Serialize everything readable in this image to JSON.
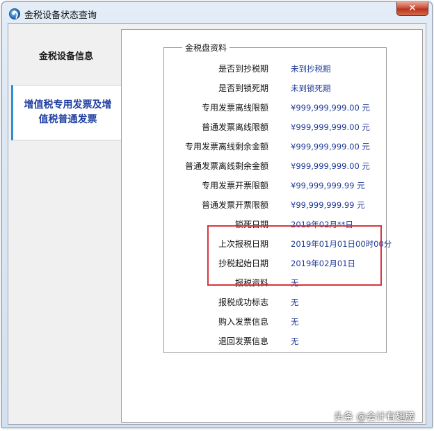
{
  "window": {
    "title": "金税设备状态查询",
    "close_glyph": "✕"
  },
  "nav": {
    "items": [
      {
        "label": "金税设备信息"
      },
      {
        "label": "增值税专用发票及增值税普通发票"
      }
    ]
  },
  "group": {
    "title": "金税盘资料",
    "rows": [
      {
        "label": "是否到抄税期",
        "value": "未到抄税期"
      },
      {
        "label": "是否到锁死期",
        "value": "未到锁死期"
      },
      {
        "label": "专用发票离线限额",
        "value": "¥999,999,999.00 元"
      },
      {
        "label": "普通发票离线限额",
        "value": "¥999,999,999.00 元"
      },
      {
        "label": "专用发票离线剩余金额",
        "value": "¥999,999,999.00 元"
      },
      {
        "label": "普通发票离线剩余金额",
        "value": "¥999,999,999.00 元"
      },
      {
        "label": "专用发票开票限额",
        "value": "¥99,999,999.99 元"
      },
      {
        "label": "普通发票开票限额",
        "value": "¥99,999,999.99 元"
      },
      {
        "label": "锁死日期",
        "value": "2019年02月**日"
      },
      {
        "label": "上次报税日期",
        "value": "2019年01月01日00时00分"
      },
      {
        "label": "抄税起始日期",
        "value": "2019年02月01日"
      },
      {
        "label": "报税资料",
        "value": "无"
      },
      {
        "label": "报税成功标志",
        "value": "无"
      },
      {
        "label": "购入发票信息",
        "value": "无"
      },
      {
        "label": "退回发票信息",
        "value": "无"
      }
    ]
  },
  "watermark": {
    "text": "头条 @会计有翅膀"
  },
  "colors": {
    "highlight_border": "#d9343d",
    "value_text": "#1f3a96",
    "active_nav_text": "#1f3fa0",
    "active_nav_accent": "#2b8ed6"
  }
}
